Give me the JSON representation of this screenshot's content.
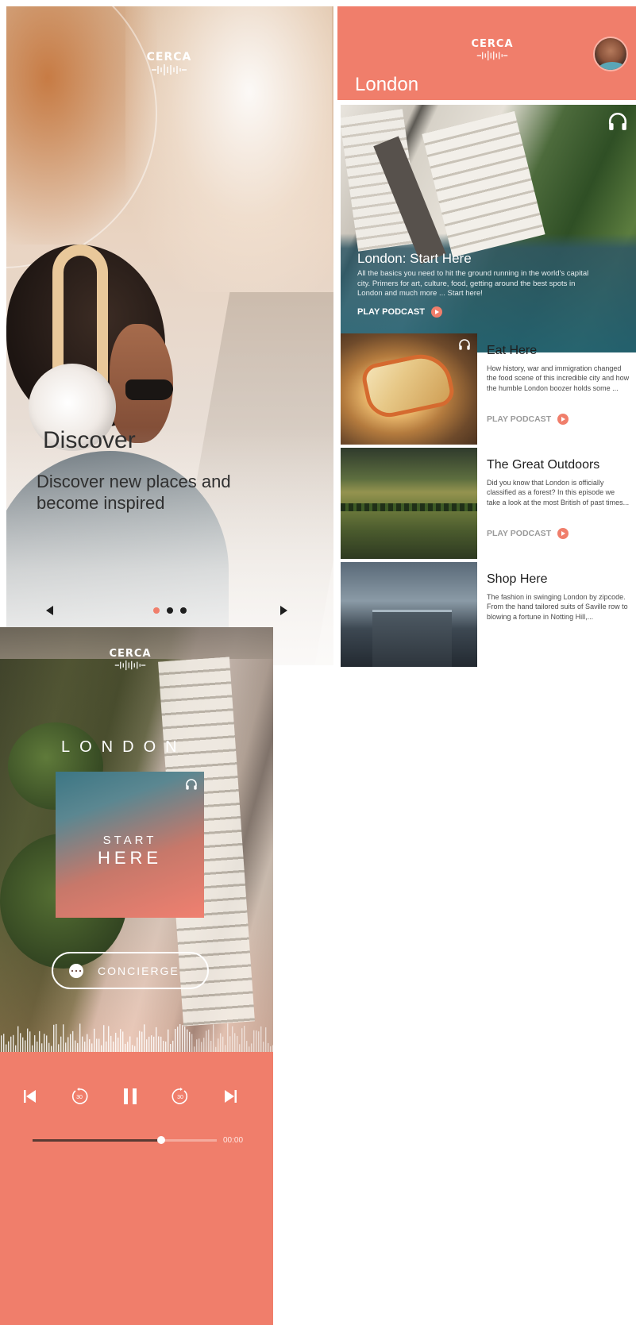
{
  "onboarding": {
    "logo_text": "CERCA",
    "title": "Discover",
    "subtitle": "Discover new places and become inspired",
    "pager": {
      "pages": 3,
      "active_index": 0
    },
    "colors": {
      "accent": "#f07e6b",
      "text": "#2f2f2f"
    }
  },
  "city_feed": {
    "logo_text": "CERCA",
    "city": "London",
    "featured": {
      "title": "London: Start Here",
      "description": "All the basics you need to hit the ground running in the world's capital city. Primers for art, culture, food, getting around the best spots in London and much more ... Start here!",
      "cta": "PLAY PODCAST"
    },
    "episodes": [
      {
        "title": "Eat Here",
        "description": "How history, war and immigration changed the food scene of this incredible city and how the humble London boozer holds some ...",
        "cta": "PLAY PODCAST"
      },
      {
        "title": "The Great Outdoors",
        "description": "Did you know that London is officially classified as a forest? In this episode we take a look at the most British of past times...",
        "cta": "PLAY PODCAST"
      },
      {
        "title": "Shop Here",
        "description": "The fashion in swinging London by zipcode. From the hand tailored suits of Saville row to blowing a fortune in Notting Hill,...",
        "cta": ""
      }
    ],
    "colors": {
      "header": "#f07e6b",
      "overlay": "#22627 3"
    }
  },
  "player": {
    "logo_text": "CERCA",
    "city_label": "LONDON",
    "card_line1": "START",
    "card_line2": "HERE",
    "concierge_label": "CONCIERGE",
    "time": "00:00",
    "progress": 0.7,
    "controls": [
      "skip-back-icon",
      "rewind-30-icon",
      "pause-icon",
      "forward-30-icon",
      "skip-forward-icon"
    ],
    "colors": {
      "panel": "#f07e6b"
    }
  }
}
